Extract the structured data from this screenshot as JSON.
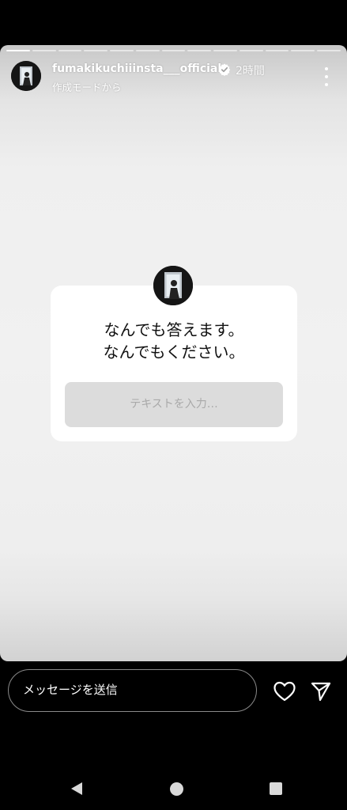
{
  "story": {
    "progress_segments": 13,
    "progress_done": 1,
    "username": "fumakikuchiiinsta___official",
    "time": "2時間",
    "subtitle": "作成モードから",
    "verified": true,
    "icons": {
      "avatar": "avatar",
      "verified": "verified-badge-icon",
      "more": "more-vertical-icon"
    }
  },
  "question": {
    "line1": "なんでも答えます。",
    "line2": "なんでもください。",
    "input_placeholder": "テキストを入力…"
  },
  "message_bar": {
    "placeholder": "メッセージを送信",
    "icons": {
      "like": "heart-icon",
      "send": "send-icon"
    }
  },
  "colors": {
    "background": "#000000",
    "story_bg": "#f1f1f1",
    "input_bg": "#dcdcdc",
    "placeholder": "#a9a9a9"
  }
}
